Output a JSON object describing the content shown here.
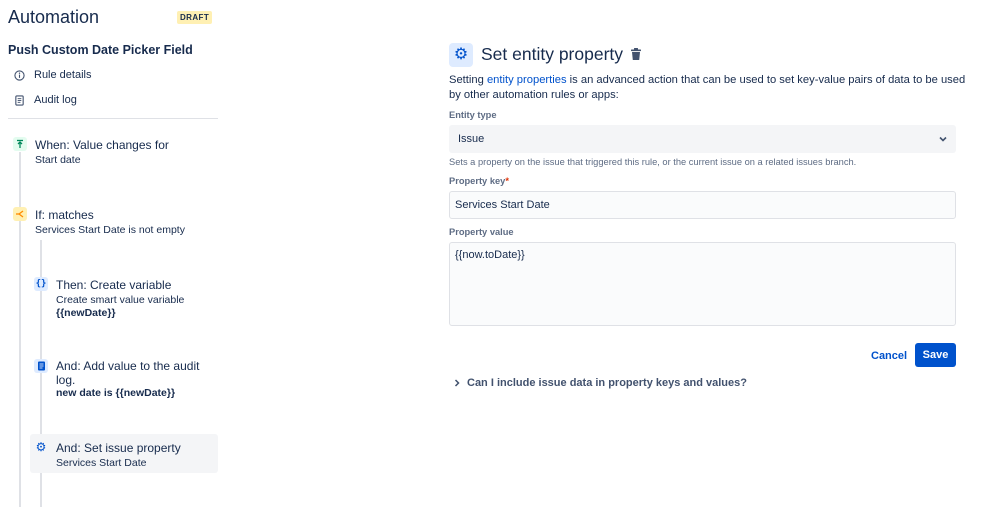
{
  "app": {
    "title": "Automation",
    "badge": "DRAFT"
  },
  "rule": {
    "name": "Push Custom Date Picker Field"
  },
  "nav": [
    {
      "label": "Rule details",
      "icon": "info-icon"
    },
    {
      "label": "Audit log",
      "icon": "document-icon"
    }
  ],
  "steps": [
    {
      "title": "When: Value changes for",
      "subtitle": "Start date",
      "icon": "trigger-icon",
      "accent": "#00875a",
      "bg": "#e3fcef"
    },
    {
      "title": "If: matches",
      "subtitle": "Services Start Date is not empty",
      "icon": "branch-condition-icon",
      "accent": "#ff991f",
      "bg": "#fff0b3"
    },
    {
      "title": "Then: Create variable",
      "subtitle": "Create smart value variable",
      "bold": "{{newDate}}",
      "icon": "braces-icon",
      "accent": "#0052cc",
      "bg": "#deebff"
    },
    {
      "title_line1": "And: Add value to the audit",
      "title_line2": "log.",
      "bold": "new date is {{newDate}}",
      "icon": "audit-log-icon",
      "accent": "#0052cc",
      "bg": "#deebff"
    },
    {
      "title": "And: Set issue property",
      "subtitle": "Services Start Date",
      "icon": "gear-icon",
      "accent": "#0052cc",
      "bg": "#deebff"
    }
  ],
  "panel": {
    "title": "Set entity property",
    "description_pre": "Setting ",
    "description_link": "entity properties",
    "description_post": " is an advanced action that can be used to set key-value pairs of data to be used by other automation rules or apps:",
    "entity_type_label": "Entity type",
    "entity_type_value": "Issue",
    "entity_type_helper": "Sets a property on the issue that triggered this rule, or the current issue on a related issues branch.",
    "property_key_label": "Property key",
    "property_key_value": "Services Start Date",
    "property_value_label": "Property value",
    "property_value_value": "{{now.toDate}}",
    "cancel_label": "Cancel",
    "save_label": "Save",
    "faq_label": "Can I include issue data in property keys and values?"
  },
  "colors": {
    "primary": "#0052cc",
    "text": "#172b4d",
    "subtle": "#5e6c84",
    "required": "#de350b"
  }
}
